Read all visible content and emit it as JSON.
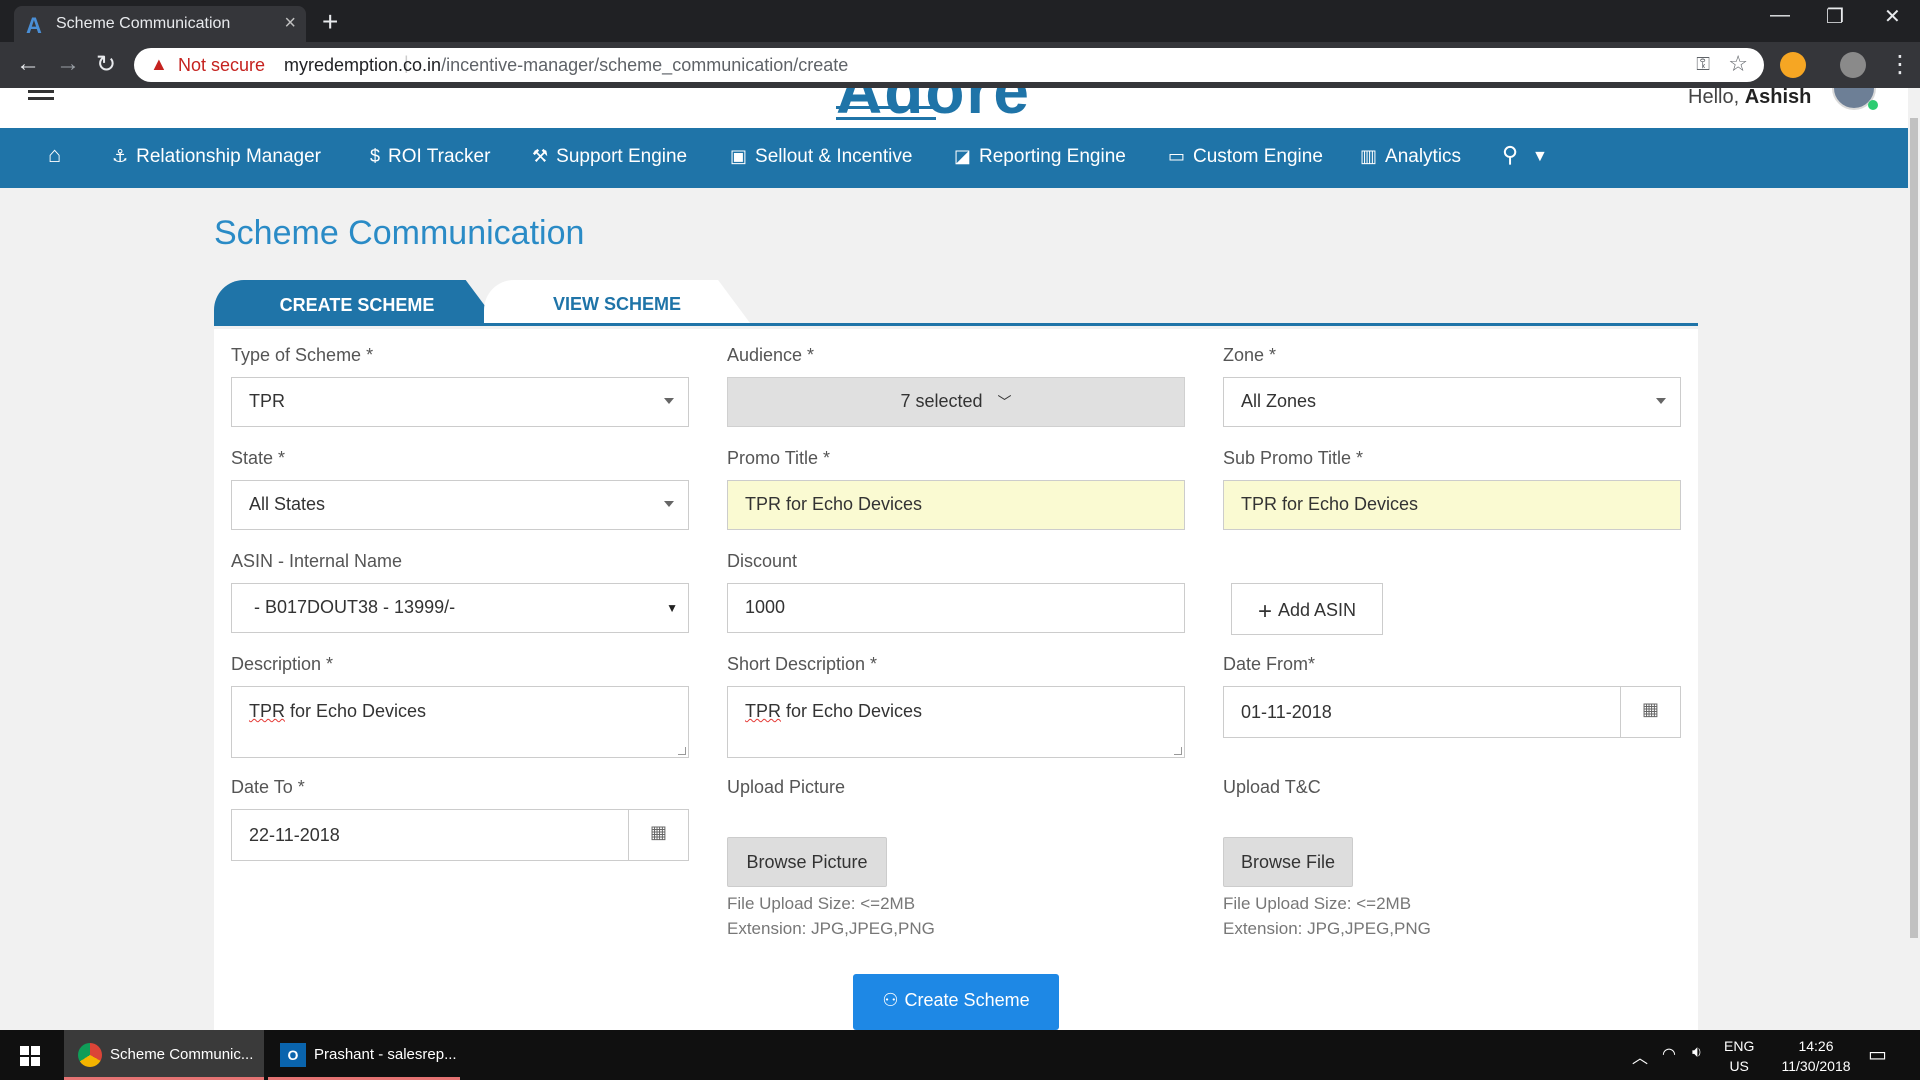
{
  "browser": {
    "tab_title": "Scheme Communication",
    "security_label": "Not secure",
    "url_host": "myredemption.co.in",
    "url_path": "/incentive-manager/scheme_communication/create"
  },
  "header": {
    "logo_text": "Adore",
    "greeting": "Hello,",
    "user_name": "Ashish"
  },
  "nav": {
    "items": [
      {
        "label": "Relationship Manager",
        "icon": "anchor-icon"
      },
      {
        "label": "ROI Tracker",
        "icon": "dollar-icon"
      },
      {
        "label": "Support Engine",
        "icon": "wrench-icon"
      },
      {
        "label": "Sellout & Incentive",
        "icon": "gift-icon"
      },
      {
        "label": "Reporting Engine",
        "icon": "chart-icon"
      },
      {
        "label": "Custom Engine",
        "icon": "monitor-icon"
      },
      {
        "label": "Analytics",
        "icon": "bar-chart-icon"
      }
    ]
  },
  "page": {
    "title": "Scheme Communication",
    "tabs": {
      "create": "CREATE SCHEME",
      "view": "VIEW SCHEME"
    }
  },
  "form": {
    "type_label": "Type of Scheme *",
    "type_value": "TPR",
    "audience_label": "Audience *",
    "audience_value": "7 selected",
    "zone_label": "Zone *",
    "zone_value": "All Zones",
    "state_label": "State *",
    "state_value": "All States",
    "promo_label": "Promo Title *",
    "promo_value": "TPR for Echo Devices",
    "subpromo_label": "Sub Promo Title *",
    "subpromo_value": "TPR for Echo Devices",
    "asin_label": "ASIN - Internal Name",
    "asin_value": "- B017DOUT38 - 13999/-",
    "discount_label": "Discount",
    "discount_value": "1000",
    "add_asin": "Add ASIN",
    "desc_label": "Description *",
    "desc_value_word1": "TPR",
    "desc_value_rest": " for Echo Devices",
    "short_desc_label": "Short Description *",
    "short_desc_word1": "TPR",
    "short_desc_rest": " for Echo Devices",
    "date_from_label": "Date From*",
    "date_from_value": "01-11-2018",
    "date_to_label": "Date To *",
    "date_to_value": "22-11-2018",
    "upload_pic_label": "Upload Picture",
    "browse_picture": "Browse Picture",
    "upload_tc_label": "Upload T&C",
    "browse_file": "Browse File",
    "hint_size": "File Upload Size: <=2MB",
    "hint_ext": "Extension: JPG,JPEG,PNG",
    "submit": "Create Scheme"
  },
  "taskbar": {
    "task1": "Scheme Communic...",
    "task2": "Prashant - salesrep...",
    "lang1": "ENG",
    "lang2": "US",
    "time": "14:26",
    "date": "11/30/2018"
  }
}
